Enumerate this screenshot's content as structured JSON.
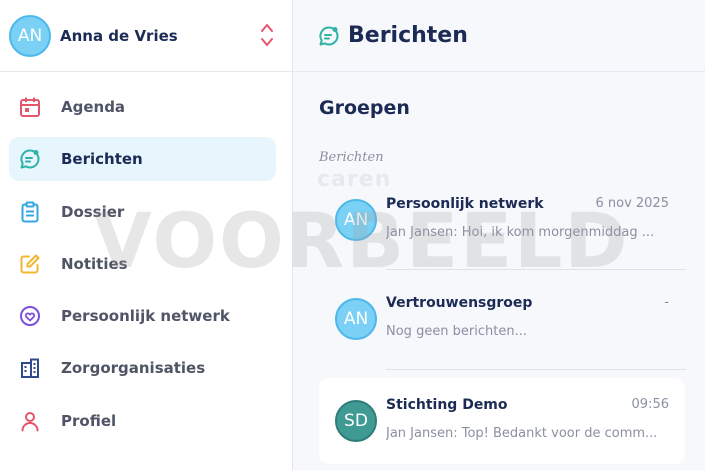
{
  "user": {
    "initials": "AN",
    "name": "Anna de Vries"
  },
  "nav": [
    {
      "label": "Agenda",
      "icon": "calendar-icon",
      "color": "#e5556b",
      "active": false
    },
    {
      "label": "Berichten",
      "icon": "chat-icon",
      "color": "#2fb3a6",
      "active": true
    },
    {
      "label": "Dossier",
      "icon": "clipboard-icon",
      "color": "#35a7e0",
      "active": false
    },
    {
      "label": "Notities",
      "icon": "note-edit-icon",
      "color": "#f2b731",
      "active": false
    },
    {
      "label": "Persoonlijk netwerk",
      "icon": "heart-circle-icon",
      "color": "#7d4fe0",
      "active": false
    },
    {
      "label": "Zorgorganisaties",
      "icon": "building-icon",
      "color": "#2e4a8a",
      "active": false
    },
    {
      "label": "Profiel",
      "icon": "person-icon",
      "color": "#e5556b",
      "active": false
    }
  ],
  "header": {
    "title": "Berichten",
    "icon": "chat-icon"
  },
  "section": {
    "title": "Groepen",
    "group_label": "Berichten",
    "brand": "caren"
  },
  "conversations": [
    {
      "initials": "AN",
      "name": "Persoonlijk netwerk",
      "time": "6 nov 2025",
      "preview": "Jan Jansen: Hoi, ik kom morgenmiddag ...",
      "avatar_color": "blue",
      "selected": false
    },
    {
      "initials": "AN",
      "name": "Vertrouwensgroep",
      "time": "-",
      "preview": "Nog geen berichten...",
      "avatar_color": "blue",
      "selected": false
    },
    {
      "initials": "SD",
      "name": "Stichting Demo",
      "time": "09:56",
      "preview": "Jan Jansen: Top! Bedankt voor de comm...",
      "avatar_color": "teal",
      "selected": true
    }
  ],
  "watermark": "VOORBEELD",
  "colors": {
    "accent_teal": "#2fb3a6",
    "title_navy": "#1b2b55",
    "active_bg": "#e7f5fc",
    "switcher": "#e5556b"
  }
}
